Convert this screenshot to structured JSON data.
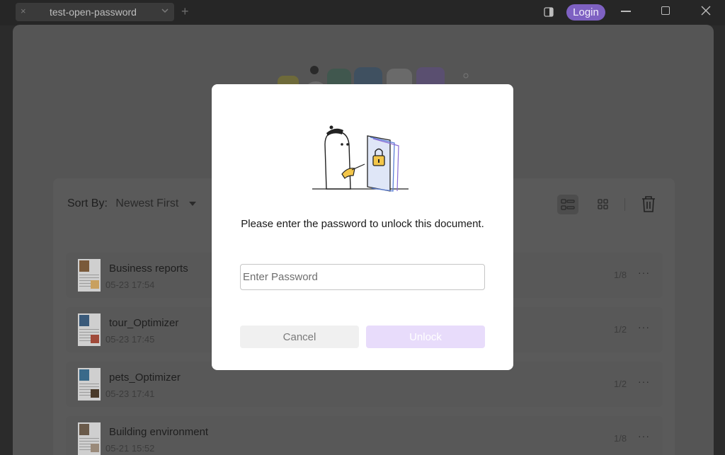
{
  "titlebar": {
    "tab_title": "test-open-password",
    "tab_close_glyph": "×",
    "new_tab_glyph": "+",
    "login_label": "Login"
  },
  "toolbar": {
    "sort_label": "Sort By:",
    "sort_value": "Newest First"
  },
  "files": [
    {
      "name": "Business reports",
      "date": "05-23 17:54",
      "pages": "1/8"
    },
    {
      "name": "tour_Optimizer",
      "date": "05-23 17:45",
      "pages": "1/2"
    },
    {
      "name": "pets_Optimizer",
      "date": "05-23 17:41",
      "pages": "1/2"
    },
    {
      "name": "Building environment",
      "date": "05-21 15:52",
      "pages": "1/8"
    }
  ],
  "more_glyph": "···",
  "dialog": {
    "prompt": "Please enter the password to unlock this document.",
    "password_placeholder": "Enter Password",
    "password_value": "",
    "cancel_label": "Cancel",
    "unlock_label": "Unlock"
  },
  "colors": {
    "accent": "#7e61c2",
    "unlock_disabled": "#e8dcfb",
    "overlay_bg": "#555555"
  },
  "icons": [
    "close-icon",
    "chevron-down-icon",
    "panel-icon",
    "minimize-icon",
    "maximize-icon",
    "list-view-icon",
    "grid-view-icon",
    "trash-icon",
    "lock-icon",
    "more-icon"
  ]
}
